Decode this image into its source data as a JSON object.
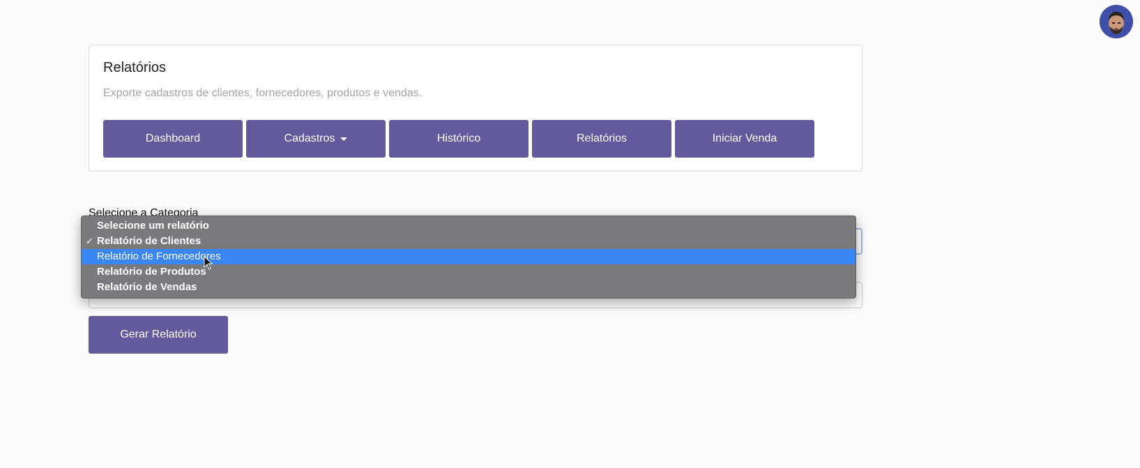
{
  "header": {
    "avatar_alt": "user avatar"
  },
  "card": {
    "title": "Relatórios",
    "subtitle": "Exporte cadastros de clientes, fornecedores, produtos e vendas.",
    "nav": [
      {
        "label": "Dashboard"
      },
      {
        "label": "Cadastros",
        "has_caret": true
      },
      {
        "label": "Histórico"
      },
      {
        "label": "Relatórios"
      },
      {
        "label": "Iniciar Venda"
      }
    ]
  },
  "form": {
    "category_label": "Selecione a Categoria",
    "report_select": {
      "selected": "Relatório de Clientes",
      "highlighted": "Relatório de Fornecedores",
      "options": [
        "Selecione um relatório",
        "Relatório de Clientes",
        "Relatório de Fornecedores",
        "Relatório de Produtos",
        "Relatório de Vendas"
      ],
      "checkmark": "✓"
    },
    "generate_label": "Gerar Relatório"
  },
  "colors": {
    "primary": "#635a9e",
    "highlight": "#3a86f5",
    "dropdown_bg": "#76767a"
  }
}
